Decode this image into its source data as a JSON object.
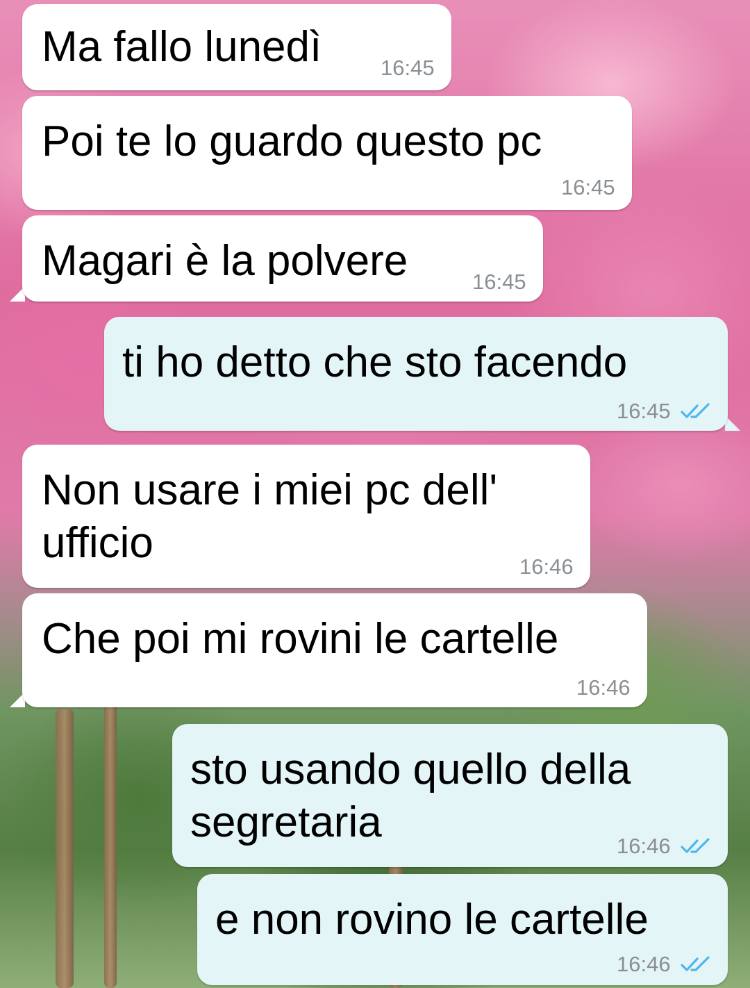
{
  "chat": {
    "messages": [
      {
        "direction": "incoming",
        "text": "Ma fallo lunedì",
        "time": "16:45"
      },
      {
        "direction": "incoming",
        "text": "Poi te lo guardo questo pc",
        "time": "16:45"
      },
      {
        "direction": "incoming",
        "text": "Magari è la polvere",
        "time": "16:45"
      },
      {
        "direction": "outgoing",
        "text": "ti ho detto che sto facendo",
        "time": "16:45",
        "status_icon": "double-check-icon"
      },
      {
        "direction": "incoming",
        "text": "Non usare i miei pc dell'\nufficio",
        "time": "16:46"
      },
      {
        "direction": "incoming",
        "text": "Che poi mi rovini le cartelle",
        "time": "16:46"
      },
      {
        "direction": "outgoing",
        "text": "sto usando quello della\nsegretaria",
        "time": "16:46",
        "status_icon": "double-check-icon"
      },
      {
        "direction": "outgoing",
        "text": "e non rovino le cartelle",
        "time": "16:46",
        "status_icon": "double-check-icon"
      }
    ]
  },
  "colors": {
    "incoming_bubble": "#ffffff",
    "outgoing_bubble": "#e4f5f7",
    "timestamp": "#8a8f93",
    "read_ticks": "#4fb6ec"
  }
}
